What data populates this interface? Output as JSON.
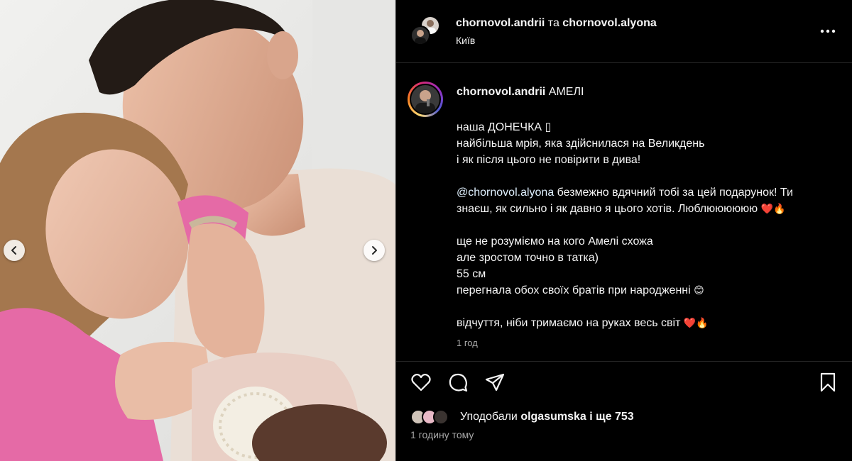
{
  "header": {
    "author": "chornovol.andrii",
    "conjunction": "та",
    "coauthor": "chornovol.alyona",
    "location": "Київ",
    "more_icon": "more-horizontal-icon"
  },
  "caption": {
    "username": "chornovol.andrii",
    "title": "АМЕЛІ",
    "lines": {
      "l1": "наша ДОНЕЧКА ",
      "l1_glyph": "▯",
      "l2": "найбільша мрія, яка здійснилася на Великдень",
      "l3": "і як після цього не повірити в дива!",
      "l4_mention": "@chornovol.alyona",
      "l4_rest": " безмежно вдячний тобі за цей подарунок! Ти",
      "l5": "знаєш, як сильно і як давно я цього хотів. Люблюююююю ",
      "l6": "ще не розуміємо на кого Амелі схожа",
      "l7": "але зростом точно в татка)",
      "l8": "55 см",
      "l9": "перегнала обох своїх братів при народженні ",
      "l10": "відчуття, ніби тримаємо на руках весь світ "
    },
    "emoji": {
      "heart": "❤️",
      "fire": "🔥",
      "smile": "😊"
    },
    "time": "1 год"
  },
  "actions": {
    "icons": [
      "heart-icon",
      "comment-icon",
      "share-icon",
      "bookmark-icon"
    ]
  },
  "likes": {
    "prefix": "Уподобали ",
    "user": "olgasumska",
    "suffix": " і ще 753"
  },
  "post_age": "1 годину тому",
  "colors": {
    "background": "#000000",
    "text": "#f5f5f5",
    "muted": "#a8a8a8",
    "divider": "#262626",
    "heart": "#e0245e"
  }
}
